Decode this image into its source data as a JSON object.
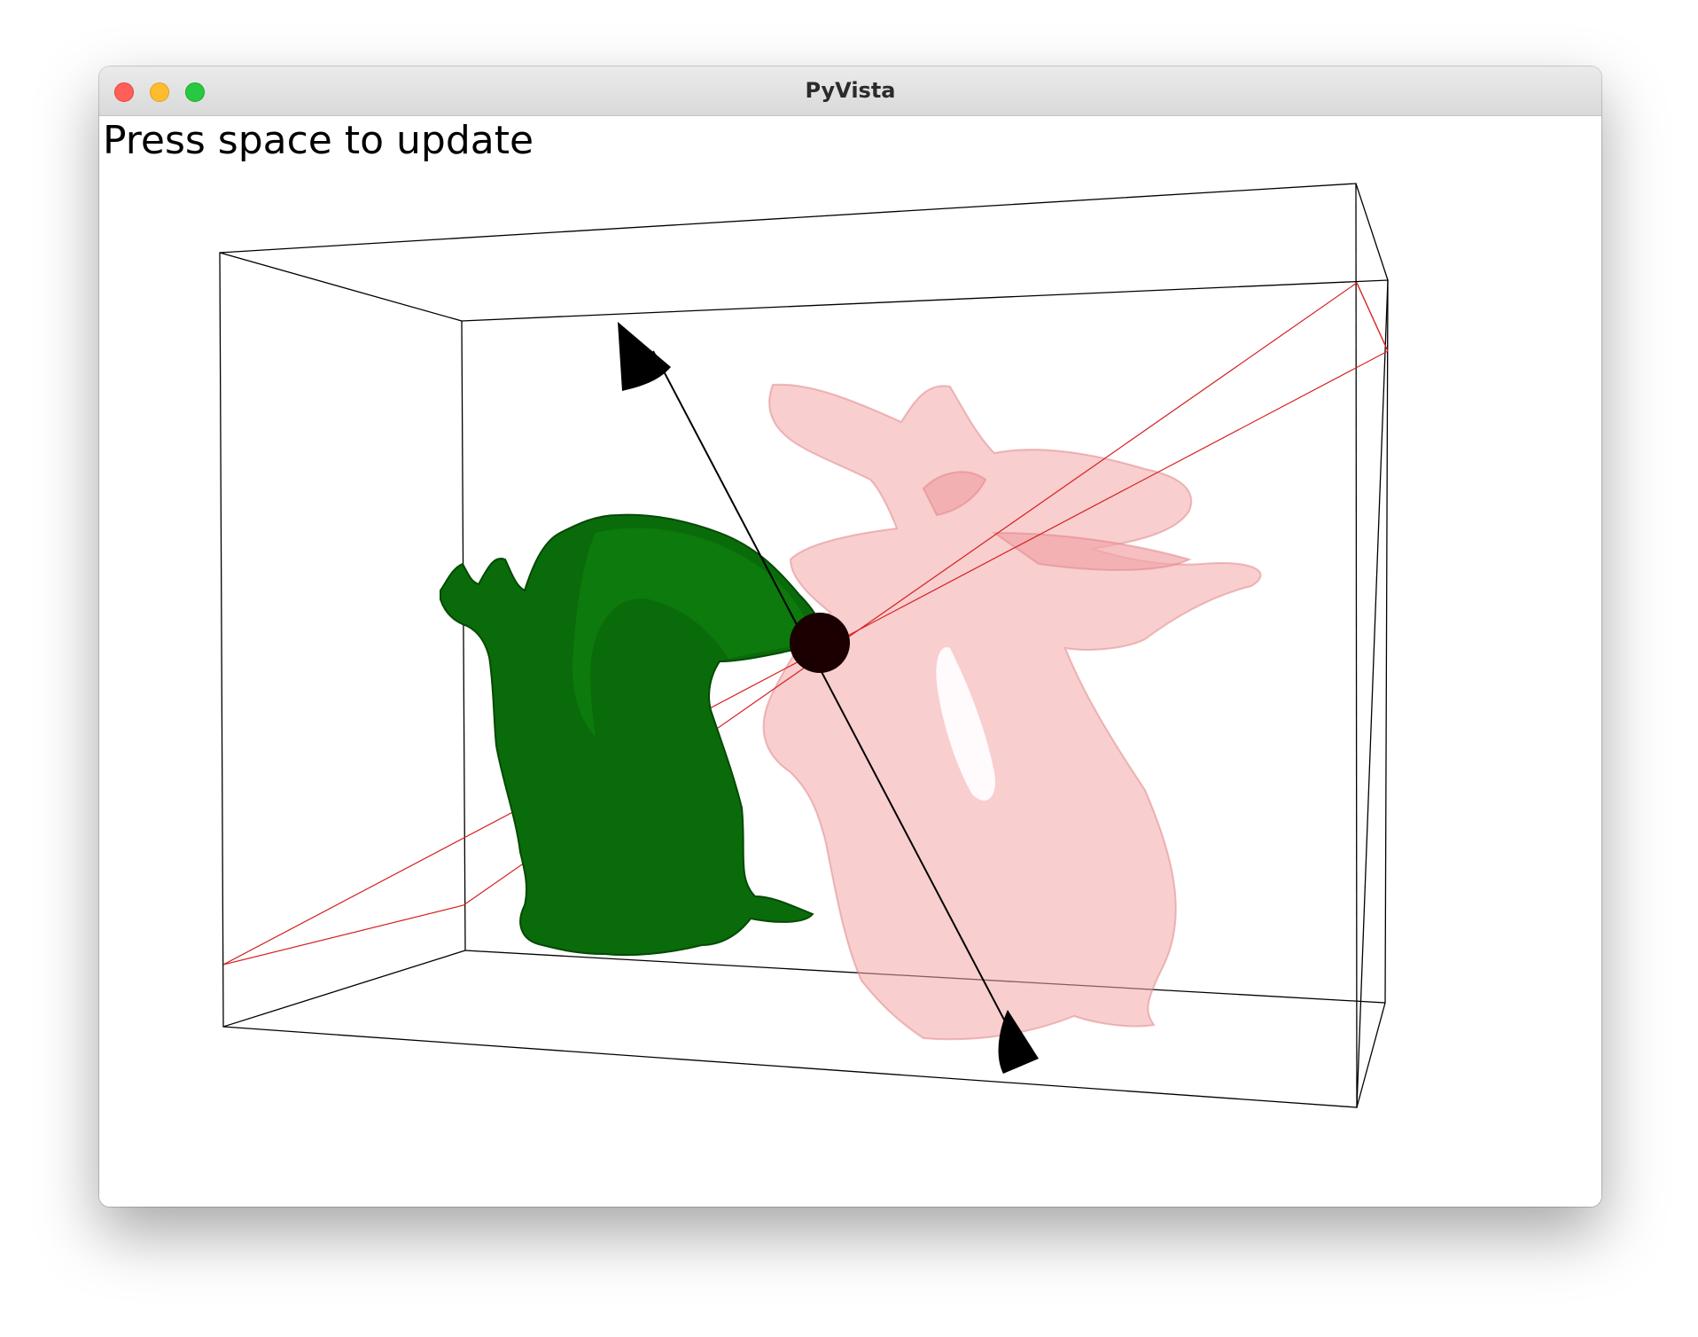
{
  "window": {
    "title": "PyVista"
  },
  "viewport": {
    "hint_text": "Press space to update",
    "background_color": "#ffffff"
  },
  "scene": {
    "bounding_box_color": "#000000",
    "plane_outline_color": "#d62020",
    "moving_mesh_color": "#0a6b0a",
    "target_mesh_color": "#f2a5a8",
    "widget_color": "#000000",
    "widget_handle_color": "#1a0000"
  },
  "icons": {
    "close": "close-dot-icon",
    "minimize": "minimize-dot-icon",
    "maximize": "maximize-dot-icon"
  }
}
